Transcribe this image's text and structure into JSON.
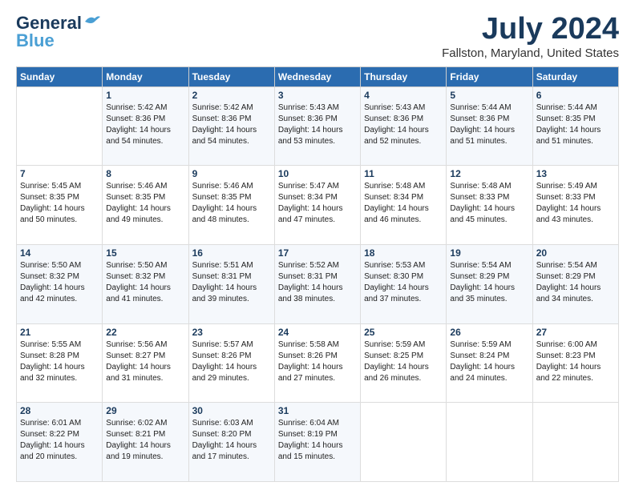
{
  "logo": {
    "line1": "General",
    "line2": "Blue"
  },
  "title": "July 2024",
  "subtitle": "Fallston, Maryland, United States",
  "days_of_week": [
    "Sunday",
    "Monday",
    "Tuesday",
    "Wednesday",
    "Thursday",
    "Friday",
    "Saturday"
  ],
  "weeks": [
    [
      {
        "day": "",
        "info": ""
      },
      {
        "day": "1",
        "info": "Sunrise: 5:42 AM\nSunset: 8:36 PM\nDaylight: 14 hours\nand 54 minutes."
      },
      {
        "day": "2",
        "info": "Sunrise: 5:42 AM\nSunset: 8:36 PM\nDaylight: 14 hours\nand 54 minutes."
      },
      {
        "day": "3",
        "info": "Sunrise: 5:43 AM\nSunset: 8:36 PM\nDaylight: 14 hours\nand 53 minutes."
      },
      {
        "day": "4",
        "info": "Sunrise: 5:43 AM\nSunset: 8:36 PM\nDaylight: 14 hours\nand 52 minutes."
      },
      {
        "day": "5",
        "info": "Sunrise: 5:44 AM\nSunset: 8:36 PM\nDaylight: 14 hours\nand 51 minutes."
      },
      {
        "day": "6",
        "info": "Sunrise: 5:44 AM\nSunset: 8:35 PM\nDaylight: 14 hours\nand 51 minutes."
      }
    ],
    [
      {
        "day": "7",
        "info": "Sunrise: 5:45 AM\nSunset: 8:35 PM\nDaylight: 14 hours\nand 50 minutes."
      },
      {
        "day": "8",
        "info": "Sunrise: 5:46 AM\nSunset: 8:35 PM\nDaylight: 14 hours\nand 49 minutes."
      },
      {
        "day": "9",
        "info": "Sunrise: 5:46 AM\nSunset: 8:35 PM\nDaylight: 14 hours\nand 48 minutes."
      },
      {
        "day": "10",
        "info": "Sunrise: 5:47 AM\nSunset: 8:34 PM\nDaylight: 14 hours\nand 47 minutes."
      },
      {
        "day": "11",
        "info": "Sunrise: 5:48 AM\nSunset: 8:34 PM\nDaylight: 14 hours\nand 46 minutes."
      },
      {
        "day": "12",
        "info": "Sunrise: 5:48 AM\nSunset: 8:33 PM\nDaylight: 14 hours\nand 45 minutes."
      },
      {
        "day": "13",
        "info": "Sunrise: 5:49 AM\nSunset: 8:33 PM\nDaylight: 14 hours\nand 43 minutes."
      }
    ],
    [
      {
        "day": "14",
        "info": "Sunrise: 5:50 AM\nSunset: 8:32 PM\nDaylight: 14 hours\nand 42 minutes."
      },
      {
        "day": "15",
        "info": "Sunrise: 5:50 AM\nSunset: 8:32 PM\nDaylight: 14 hours\nand 41 minutes."
      },
      {
        "day": "16",
        "info": "Sunrise: 5:51 AM\nSunset: 8:31 PM\nDaylight: 14 hours\nand 39 minutes."
      },
      {
        "day": "17",
        "info": "Sunrise: 5:52 AM\nSunset: 8:31 PM\nDaylight: 14 hours\nand 38 minutes."
      },
      {
        "day": "18",
        "info": "Sunrise: 5:53 AM\nSunset: 8:30 PM\nDaylight: 14 hours\nand 37 minutes."
      },
      {
        "day": "19",
        "info": "Sunrise: 5:54 AM\nSunset: 8:29 PM\nDaylight: 14 hours\nand 35 minutes."
      },
      {
        "day": "20",
        "info": "Sunrise: 5:54 AM\nSunset: 8:29 PM\nDaylight: 14 hours\nand 34 minutes."
      }
    ],
    [
      {
        "day": "21",
        "info": "Sunrise: 5:55 AM\nSunset: 8:28 PM\nDaylight: 14 hours\nand 32 minutes."
      },
      {
        "day": "22",
        "info": "Sunrise: 5:56 AM\nSunset: 8:27 PM\nDaylight: 14 hours\nand 31 minutes."
      },
      {
        "day": "23",
        "info": "Sunrise: 5:57 AM\nSunset: 8:26 PM\nDaylight: 14 hours\nand 29 minutes."
      },
      {
        "day": "24",
        "info": "Sunrise: 5:58 AM\nSunset: 8:26 PM\nDaylight: 14 hours\nand 27 minutes."
      },
      {
        "day": "25",
        "info": "Sunrise: 5:59 AM\nSunset: 8:25 PM\nDaylight: 14 hours\nand 26 minutes."
      },
      {
        "day": "26",
        "info": "Sunrise: 5:59 AM\nSunset: 8:24 PM\nDaylight: 14 hours\nand 24 minutes."
      },
      {
        "day": "27",
        "info": "Sunrise: 6:00 AM\nSunset: 8:23 PM\nDaylight: 14 hours\nand 22 minutes."
      }
    ],
    [
      {
        "day": "28",
        "info": "Sunrise: 6:01 AM\nSunset: 8:22 PM\nDaylight: 14 hours\nand 20 minutes."
      },
      {
        "day": "29",
        "info": "Sunrise: 6:02 AM\nSunset: 8:21 PM\nDaylight: 14 hours\nand 19 minutes."
      },
      {
        "day": "30",
        "info": "Sunrise: 6:03 AM\nSunset: 8:20 PM\nDaylight: 14 hours\nand 17 minutes."
      },
      {
        "day": "31",
        "info": "Sunrise: 6:04 AM\nSunset: 8:19 PM\nDaylight: 14 hours\nand 15 minutes."
      },
      {
        "day": "",
        "info": ""
      },
      {
        "day": "",
        "info": ""
      },
      {
        "day": "",
        "info": ""
      }
    ]
  ]
}
